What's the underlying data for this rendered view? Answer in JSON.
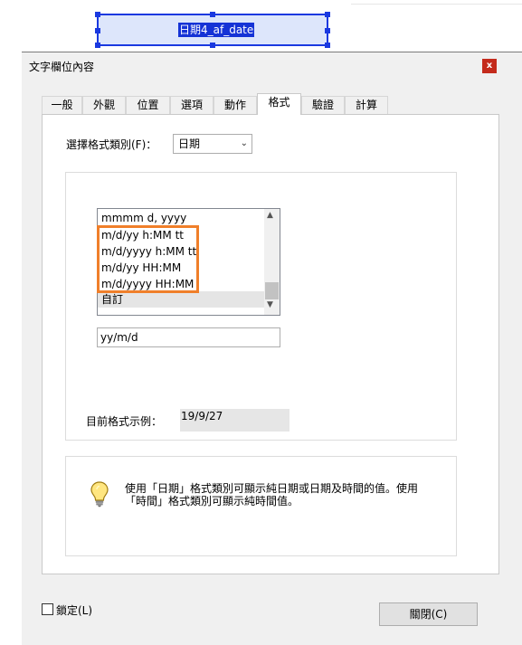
{
  "field": {
    "name": "日期4_af_date"
  },
  "dialog": {
    "title": "文字欄位內容",
    "close_icon": "x",
    "tabs": [
      "一般",
      "外觀",
      "位置",
      "選項",
      "動作",
      "格式",
      "驗證",
      "計算"
    ],
    "active_tab": "格式"
  },
  "format": {
    "category_label": "選擇格式類別(F)：",
    "category_value": "日期",
    "list_items": [
      "mmmm d, yyyy",
      "m/d/yy h:MM tt",
      "m/d/yyyy h:MM tt",
      "m/d/yy HH:MM",
      "m/d/yyyy HH:MM",
      "自訂"
    ],
    "selected_item": "自訂",
    "custom_value": "yy/m/d",
    "sample_label": "目前格式示例：",
    "sample_value": "19/9/27"
  },
  "hint": {
    "icon": "lightbulb-icon",
    "text": "使用「日期」格式類別可顯示純日期或日期及時間的值。使用「時間」格式類別可顯示純時間值。"
  },
  "footer": {
    "lock_label": "鎖定(L)",
    "close_label": "關閉(C)"
  },
  "colors": {
    "selection_blue": "#1a39e0",
    "highlight_orange": "#f07f2a",
    "close_red": "#c42b1c"
  }
}
